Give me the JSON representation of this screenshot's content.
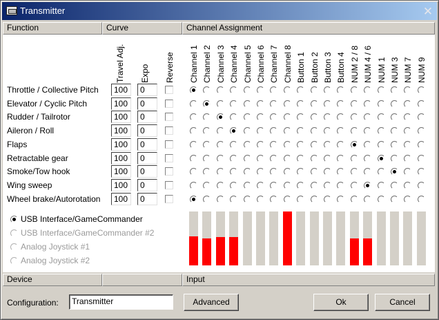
{
  "window": {
    "title": "Transmitter"
  },
  "headers": {
    "function": "Function",
    "curve": "Curve",
    "channel_assignment": "Channel Assignment",
    "device": "Device",
    "input": "Input"
  },
  "columns": {
    "travel_adj": "Travel Adj.",
    "expo": "Expo",
    "reverse": "Reverse"
  },
  "channels": [
    "Channel 1",
    "Channel 2",
    "Channel 3",
    "Channel 4",
    "Channel 5",
    "Channel 6",
    "Channel 7",
    "Channel 8",
    "Button 1",
    "Button 2",
    "Button 3",
    "Button 4",
    "NUM 2 / 8",
    "NUM 4 / 6",
    "NUM 1",
    "NUM 3",
    "NUM 7",
    "NUM 9"
  ],
  "functions": [
    {
      "label": "Throttle / Collective Pitch",
      "travel": "100",
      "expo": "0",
      "reverse": false,
      "channel": 0
    },
    {
      "label": "Elevator / Cyclic Pitch",
      "travel": "100",
      "expo": "0",
      "reverse": false,
      "channel": 1
    },
    {
      "label": "Rudder / Tailrotor",
      "travel": "100",
      "expo": "0",
      "reverse": false,
      "channel": 2
    },
    {
      "label": "Aileron / Roll",
      "travel": "100",
      "expo": "0",
      "reverse": false,
      "channel": 3
    },
    {
      "label": "Flaps",
      "travel": "100",
      "expo": "0",
      "reverse": false,
      "channel": 12
    },
    {
      "label": "Retractable gear",
      "travel": "100",
      "expo": "0",
      "reverse": false,
      "channel": 14
    },
    {
      "label": "Smoke/Tow hook",
      "travel": "100",
      "expo": "0",
      "reverse": false,
      "channel": 15
    },
    {
      "label": "Wing sweep",
      "travel": "100",
      "expo": "0",
      "reverse": false,
      "channel": 13
    },
    {
      "label": "Wheel brake/Autorotation",
      "travel": "100",
      "expo": "0",
      "reverse": false,
      "channel": 0
    }
  ],
  "devices": [
    {
      "label": "USB Interface/GameCommander",
      "selected": true,
      "enabled": true
    },
    {
      "label": "USB Interface/GameCommander #2",
      "selected": false,
      "enabled": false
    },
    {
      "label": "Analog Joystick #1",
      "selected": false,
      "enabled": false
    },
    {
      "label": "Analog Joystick #2",
      "selected": false,
      "enabled": false
    }
  ],
  "input_levels": [
    0.54,
    0.5,
    0.52,
    0.53,
    0,
    0,
    0,
    1.0,
    0,
    0,
    0,
    0,
    0.5,
    0.5,
    0,
    0,
    0,
    0
  ],
  "colors": {
    "title_start": "#0a246a",
    "title_end": "#a6caf0",
    "bar_fill": "#ff0000",
    "bar_empty": "#d4d0c8"
  },
  "footer": {
    "config_label": "Configuration:",
    "config_value": "Transmitter",
    "advanced": "Advanced",
    "ok": "Ok",
    "cancel": "Cancel"
  }
}
